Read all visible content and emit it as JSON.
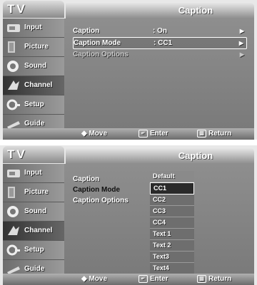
{
  "screen1": {
    "tv_title": "TV",
    "header_title": "Caption",
    "sidebar": [
      {
        "label": "Input",
        "icon": "input-icon"
      },
      {
        "label": "Picture",
        "icon": "picture-icon"
      },
      {
        "label": "Sound",
        "icon": "sound-icon"
      },
      {
        "label": "Channel",
        "icon": "channel-icon"
      },
      {
        "label": "Setup",
        "icon": "setup-icon"
      },
      {
        "label": "Guide",
        "icon": "guide-icon"
      }
    ],
    "rows": [
      {
        "label": "Caption",
        "value": ": On",
        "arrow": "▶"
      },
      {
        "label": "Caption Mode",
        "value": ": CC1",
        "arrow": "▶"
      },
      {
        "label": "Caption Options",
        "value": "",
        "arrow": "▶"
      }
    ],
    "footer": {
      "move": "Move",
      "enter": "Enter",
      "return": "Return"
    }
  },
  "screen2": {
    "tv_title": "TV",
    "header_title": "Caption",
    "sidebar": [
      {
        "label": "Input",
        "icon": "input-icon"
      },
      {
        "label": "Picture",
        "icon": "picture-icon"
      },
      {
        "label": "Sound",
        "icon": "sound-icon"
      },
      {
        "label": "Channel",
        "icon": "channel-icon"
      },
      {
        "label": "Setup",
        "icon": "setup-icon"
      },
      {
        "label": "Guide",
        "icon": "guide-icon"
      }
    ],
    "rows": [
      {
        "label": "Caption"
      },
      {
        "label": "Caption Mode"
      },
      {
        "label": "Caption Options"
      }
    ],
    "dropdown": [
      "Default",
      "CC1",
      "CC2",
      "CC3",
      "CC4",
      "Text 1",
      "Text 2",
      "Text3",
      "Text4"
    ],
    "footer": {
      "move": "Move",
      "enter": "Enter",
      "return": "Return"
    }
  }
}
